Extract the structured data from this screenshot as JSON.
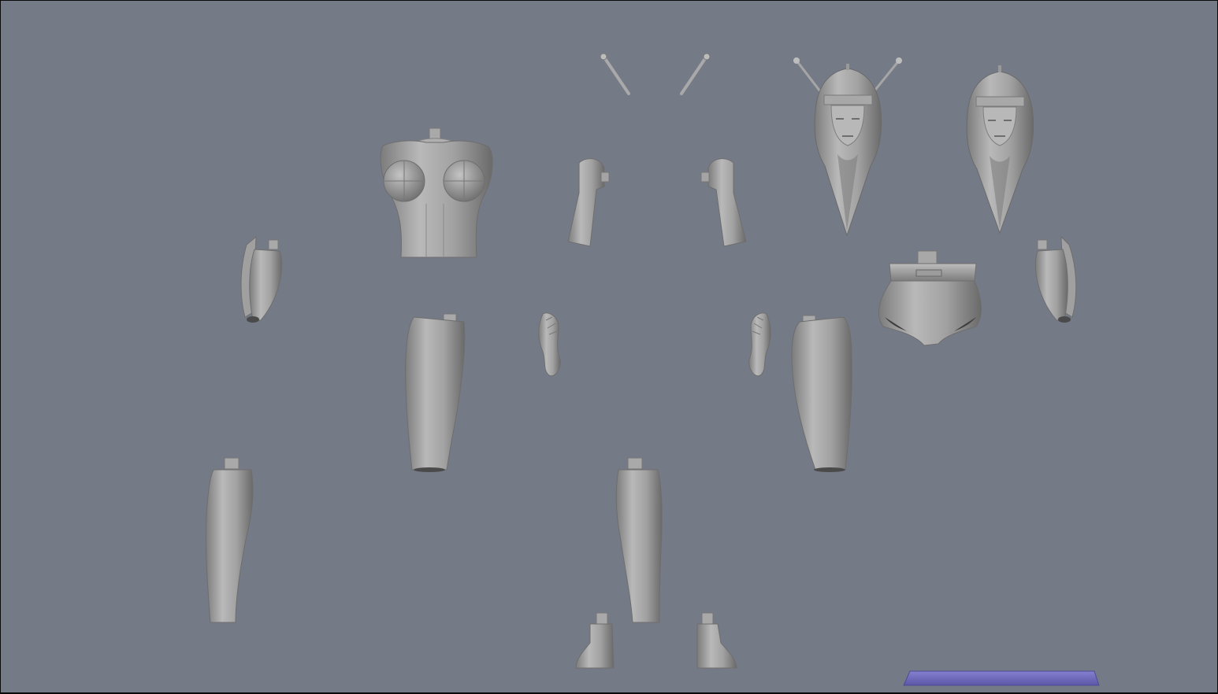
{
  "viewport": {
    "background": "#757a87",
    "frame": "#0a0a0a",
    "mesh_light": "#b4b4b4",
    "mesh_mid": "#8f8f8f",
    "mesh_dark": "#5e5e5e",
    "ground_plane": "#6a66b6"
  },
  "parts": [
    "antenna-left",
    "antenna-right",
    "head-with-antennae",
    "head-plain",
    "torso",
    "upper-arm-left",
    "upper-arm-right",
    "hip-piece",
    "forearm-left",
    "forearm-right",
    "hand-left",
    "hand-right",
    "thigh-left",
    "thigh-right",
    "shin-left",
    "shin-right",
    "foot-left",
    "foot-right"
  ]
}
